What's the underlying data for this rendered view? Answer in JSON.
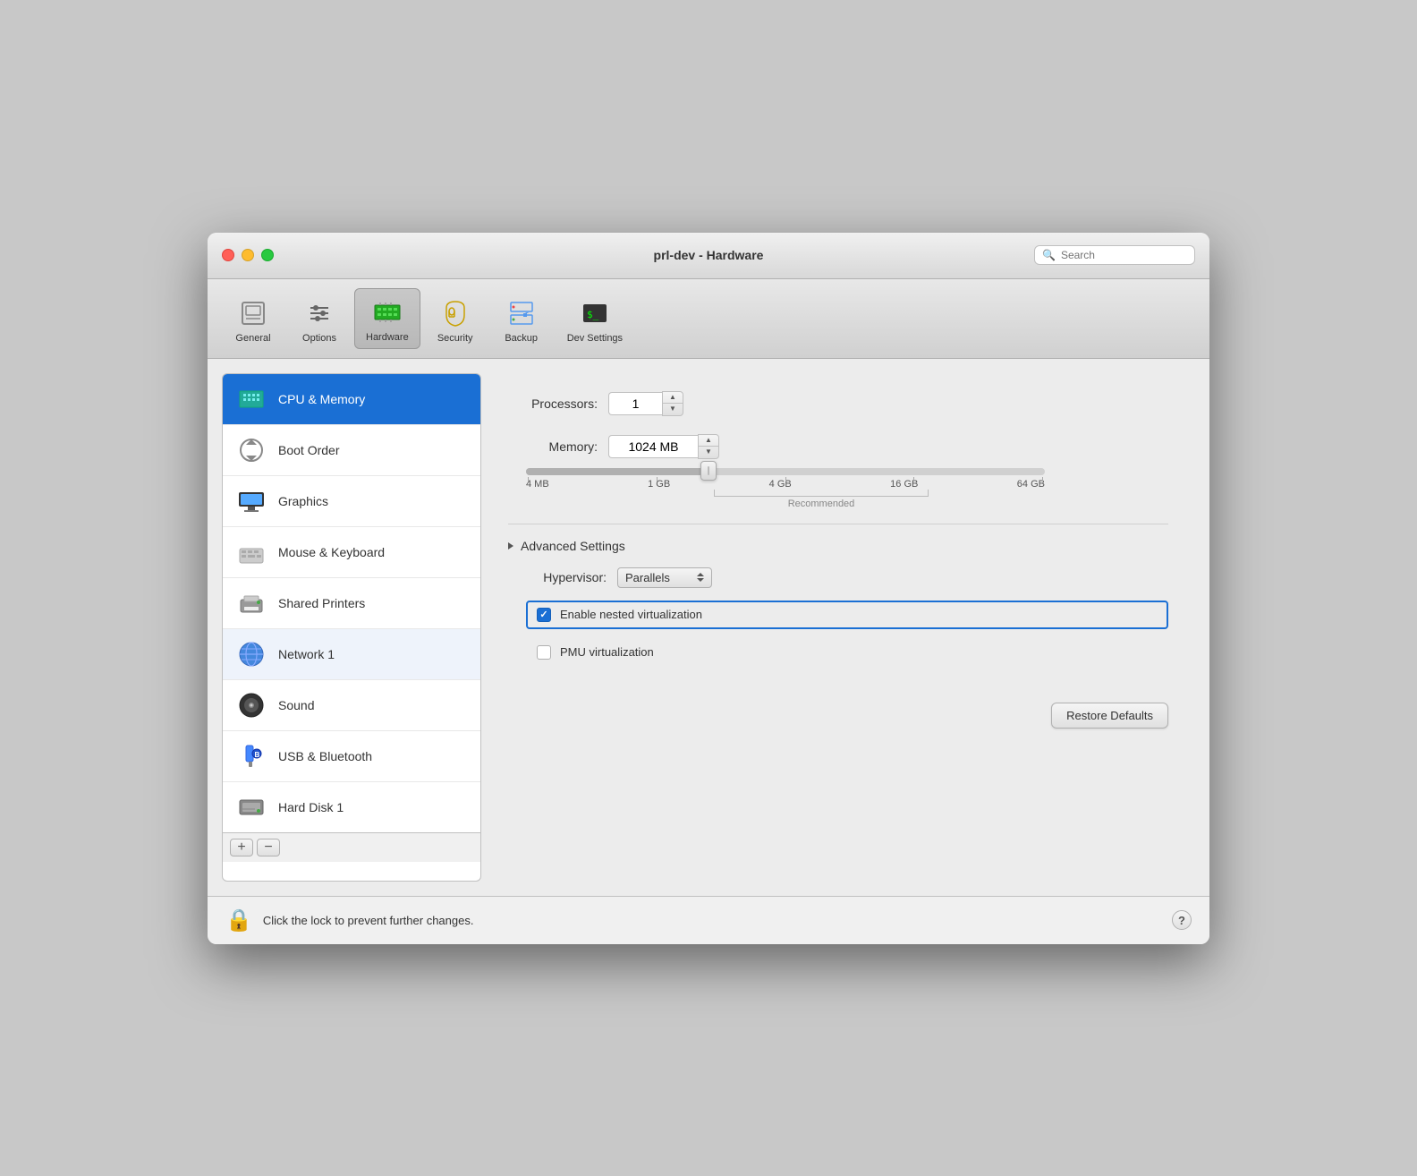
{
  "window": {
    "title": "prl-dev - Hardware"
  },
  "search": {
    "placeholder": "Search"
  },
  "toolbar": {
    "items": [
      {
        "id": "general",
        "label": "General",
        "active": false
      },
      {
        "id": "options",
        "label": "Options",
        "active": false
      },
      {
        "id": "hardware",
        "label": "Hardware",
        "active": true
      },
      {
        "id": "security",
        "label": "Security",
        "active": false
      },
      {
        "id": "backup",
        "label": "Backup",
        "active": false
      },
      {
        "id": "dev-settings",
        "label": "Dev Settings",
        "active": false
      }
    ]
  },
  "sidebar": {
    "items": [
      {
        "id": "cpu-memory",
        "label": "CPU & Memory",
        "active": true
      },
      {
        "id": "boot-order",
        "label": "Boot Order",
        "active": false
      },
      {
        "id": "graphics",
        "label": "Graphics",
        "active": false
      },
      {
        "id": "mouse-keyboard",
        "label": "Mouse & Keyboard",
        "active": false
      },
      {
        "id": "shared-printers",
        "label": "Shared Printers",
        "active": false
      },
      {
        "id": "network",
        "label": "Network 1",
        "active": false,
        "hover": true
      },
      {
        "id": "sound",
        "label": "Sound",
        "active": false
      },
      {
        "id": "usb-bluetooth",
        "label": "USB & Bluetooth",
        "active": false
      },
      {
        "id": "hard-disk",
        "label": "Hard Disk 1",
        "active": false
      }
    ],
    "add_label": "+",
    "remove_label": "−"
  },
  "main": {
    "processors_label": "Processors:",
    "processors_value": "1",
    "memory_label": "Memory:",
    "memory_value": "1024 MB",
    "slider_labels": [
      "4 MB",
      "1 GB",
      "4 GB",
      "16 GB",
      "64 GB"
    ],
    "recommended_text": "Recommended",
    "advanced_label": "Advanced Settings",
    "hypervisor_label": "Hypervisor:",
    "hypervisor_value": "Parallels",
    "nested_virt_label": "Enable nested virtualization",
    "pmu_virt_label": "PMU virtualization",
    "restore_btn": "Restore Defaults"
  },
  "footer": {
    "lock_text": "Click the lock to prevent further changes.",
    "help_label": "?"
  }
}
